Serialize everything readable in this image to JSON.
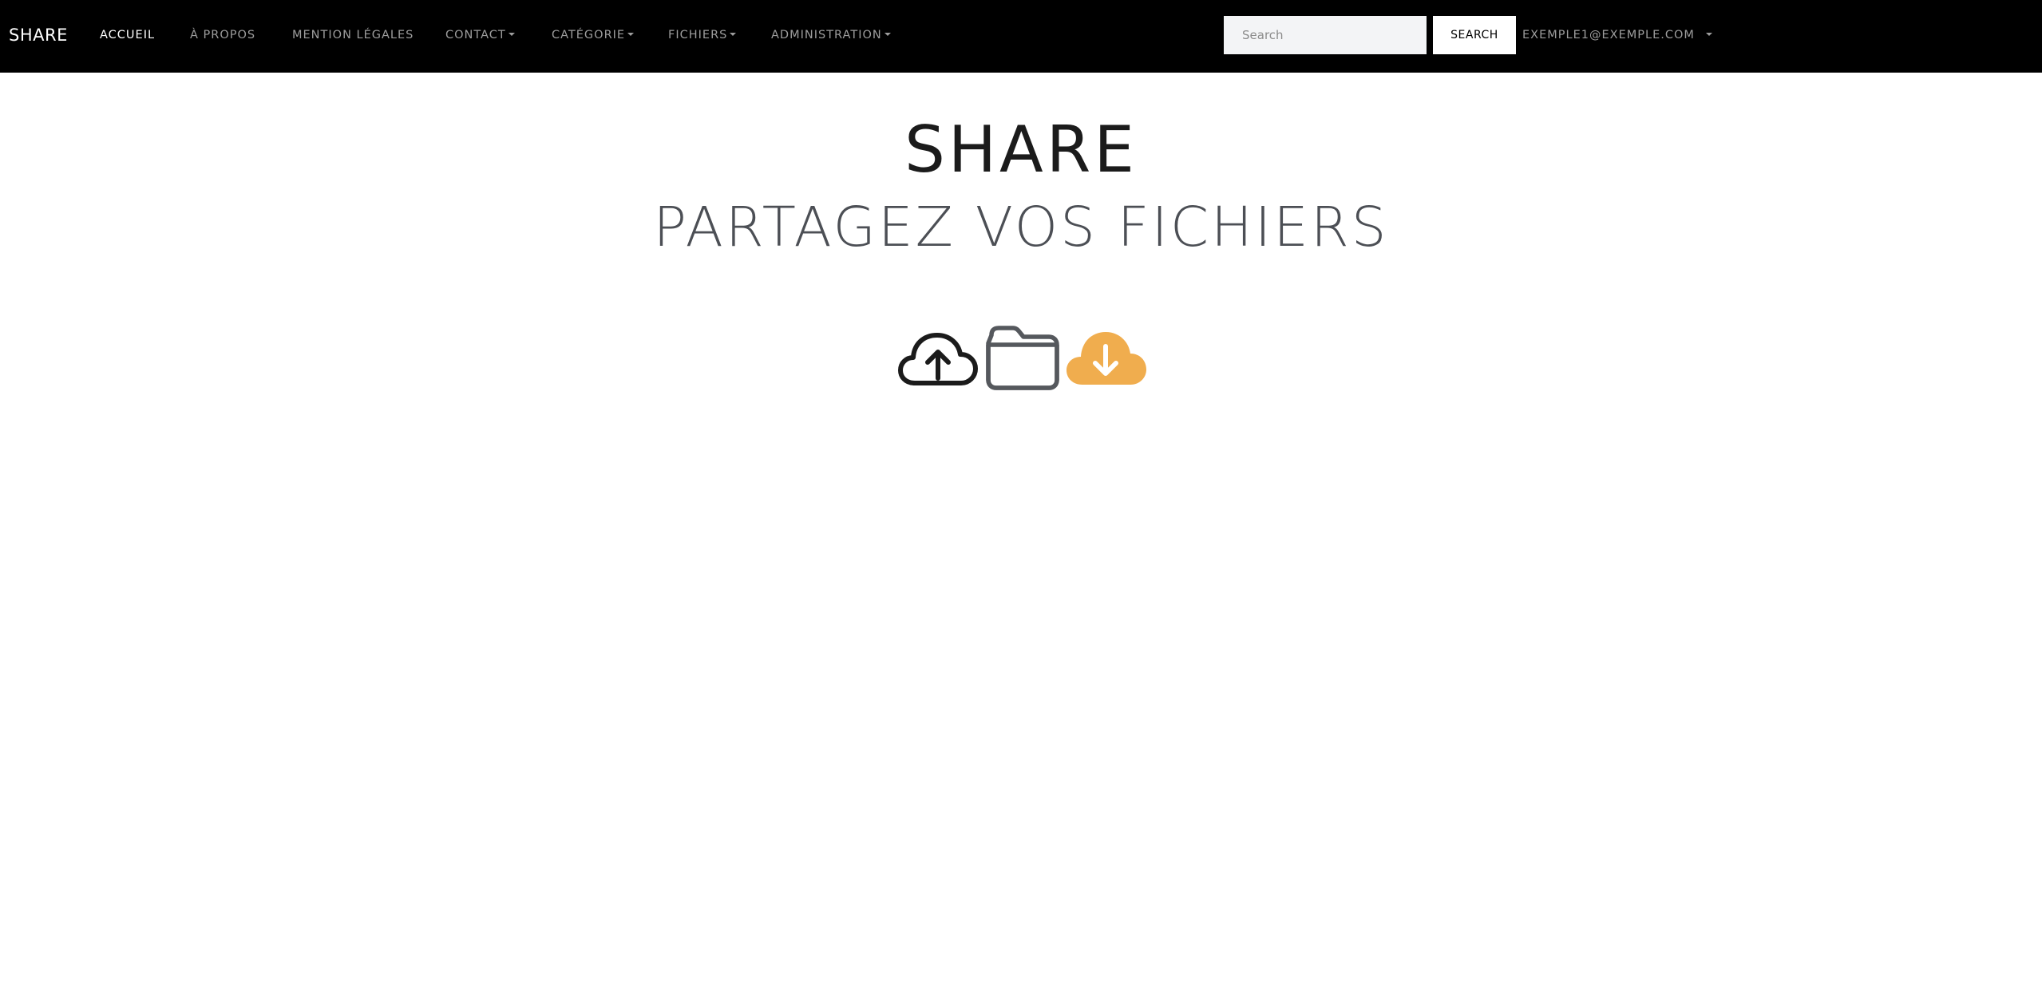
{
  "navbar": {
    "brand": "SHARE",
    "items": [
      {
        "label": "ACCUEIL",
        "active": true,
        "dropdown": false
      },
      {
        "label": "À PROPOS",
        "active": false,
        "dropdown": false
      },
      {
        "label": "MENTION LÉGALES",
        "active": false,
        "dropdown": false
      },
      {
        "label": "CONTACT",
        "active": false,
        "dropdown": true
      },
      {
        "label": "CATÉGORIE",
        "active": false,
        "dropdown": true
      },
      {
        "label": "FICHIERS",
        "active": false,
        "dropdown": true
      },
      {
        "label": "ADMINISTRATION",
        "active": false,
        "dropdown": true
      }
    ],
    "search": {
      "placeholder": "Search",
      "value": "",
      "button_label": "SEARCH"
    },
    "user": {
      "email": "EXEMPLE1@EXEMPLE.COM"
    }
  },
  "hero": {
    "title": "SHARE",
    "subtitle": "PARTAGEZ VOS FICHIERS",
    "icons": [
      {
        "name": "cloud-upload-icon",
        "color": "#1b1b1b"
      },
      {
        "name": "folder-icon",
        "color": "#55585d"
      },
      {
        "name": "cloud-download-icon",
        "color": "#f0ad4e"
      }
    ]
  },
  "colors": {
    "navbar_bg": "#000000",
    "accent": "#f0ad4e",
    "nav_text": "#9d9d9d",
    "nav_text_active": "#ffffff"
  }
}
